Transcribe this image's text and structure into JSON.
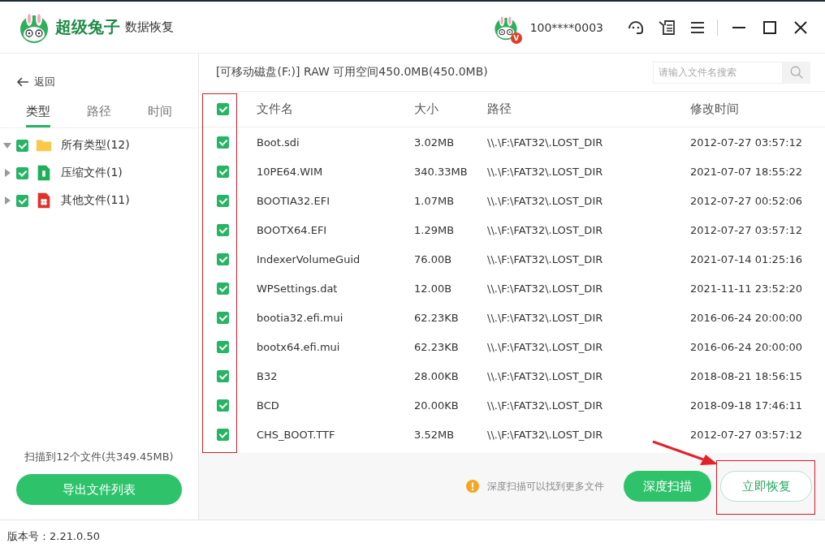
{
  "app": {
    "name": "超级兔子",
    "subtitle": "数据恢复",
    "account": "100****0003",
    "vip": "V"
  },
  "sidebar": {
    "back": "返回",
    "tabs": [
      {
        "label": "类型",
        "selected": true
      },
      {
        "label": "路径",
        "selected": false
      },
      {
        "label": "时间",
        "selected": false
      }
    ],
    "tree": [
      {
        "label": "所有类型(12)",
        "kind": "folder",
        "checked": true,
        "expanded": true,
        "children": [
          {
            "label": "压缩文件(1)",
            "kind": "archive",
            "checked": true,
            "expanded": false
          },
          {
            "label": "其他文件(11)",
            "kind": "other",
            "checked": true,
            "expanded": false
          }
        ]
      }
    ],
    "summary": "扫描到12个文件(共349.45MB)",
    "export_button": "导出文件列表"
  },
  "disk": {
    "label": "[可移动磁盘(F:)] RAW 可用空间450.0MB(450.0MB)",
    "search_placeholder": "请输入文件名搜索"
  },
  "table": {
    "all_checked": true,
    "columns": [
      "文件名",
      "大小",
      "路径",
      "修改时间"
    ],
    "rows": [
      {
        "checked": true,
        "cells": [
          "Boot.sdi",
          "3.02MB",
          "\\\\.\\F:\\FAT32\\.LOST_DIR",
          "2012-07-27 03:57:12"
        ]
      },
      {
        "checked": true,
        "cells": [
          "10PE64.WIM",
          "340.33MB",
          "\\\\.\\F:\\FAT32\\.LOST_DIR",
          "2021-07-07 18:55:22"
        ]
      },
      {
        "checked": true,
        "cells": [
          "BOOTIA32.EFI",
          "1.07MB",
          "\\\\.\\F:\\FAT32\\.LOST_DIR",
          "2012-07-27 00:52:06"
        ]
      },
      {
        "checked": true,
        "cells": [
          "BOOTX64.EFI",
          "1.29MB",
          "\\\\.\\F:\\FAT32\\.LOST_DIR",
          "2012-07-27 03:57:12"
        ]
      },
      {
        "checked": true,
        "cells": [
          "IndexerVolumeGuid",
          "76.00B",
          "\\\\.\\F:\\FAT32\\.LOST_DIR",
          "2021-07-14 01:25:16"
        ]
      },
      {
        "checked": true,
        "cells": [
          "WPSettings.dat",
          "12.00B",
          "\\\\.\\F:\\FAT32\\.LOST_DIR",
          "2021-11-11 23:52:20"
        ]
      },
      {
        "checked": true,
        "cells": [
          "bootia32.efi.mui",
          "62.23KB",
          "\\\\.\\F:\\FAT32\\.LOST_DIR",
          "2016-06-24 20:00:00"
        ]
      },
      {
        "checked": true,
        "cells": [
          "bootx64.efi.mui",
          "62.23KB",
          "\\\\.\\F:\\FAT32\\.LOST_DIR",
          "2016-06-24 20:00:00"
        ]
      },
      {
        "checked": true,
        "cells": [
          "B32",
          "28.00KB",
          "\\\\.\\F:\\FAT32\\.LOST_DIR",
          "2018-08-21 18:56:15"
        ]
      },
      {
        "checked": true,
        "cells": [
          "BCD",
          "20.00KB",
          "\\\\.\\F:\\FAT32\\.LOST_DIR",
          "2018-09-18 17:46:11"
        ]
      },
      {
        "checked": true,
        "cells": [
          "CHS_BOOT.TTF",
          "3.52MB",
          "\\\\.\\F:\\FAT32\\.LOST_DIR",
          "2012-07-27 03:57:12"
        ]
      }
    ]
  },
  "footer": {
    "tip": "深度扫描可以找到更多文件",
    "deep_scan_button": "深度扫描",
    "recover_button": "立即恢复"
  },
  "status_bar": {
    "version": "版本号：2.21.0.50"
  }
}
